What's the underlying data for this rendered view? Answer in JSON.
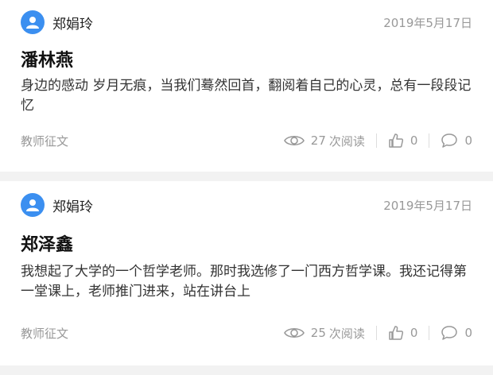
{
  "posts": [
    {
      "author": "郑娟玲",
      "date": "2019年5月17日",
      "title": "潘林燕",
      "excerpt": "身边的感动 岁月无痕，当我们蓦然回首，翻阅着自己的心灵，总有一段段记忆",
      "category": "教师征文",
      "views": "27",
      "views_label": "次阅读",
      "likes": "0",
      "comments": "0"
    },
    {
      "author": "郑娟玲",
      "date": "2019年5月17日",
      "title": "郑泽鑫",
      "excerpt": "我想起了大学的一个哲学老师。那时我选修了一门西方哲学课。我还记得第一堂课上，老师推门进来，站在讲台上",
      "category": "教师征文",
      "views": "25",
      "views_label": "次阅读",
      "likes": "0",
      "comments": "0"
    }
  ],
  "colors": {
    "avatar": "#3b8ff0",
    "muted": "#999999",
    "separator": "#f2f2f2"
  },
  "icons": [
    "user-avatar-icon",
    "eye-icon",
    "thumbs-up-icon",
    "comment-icon"
  ]
}
